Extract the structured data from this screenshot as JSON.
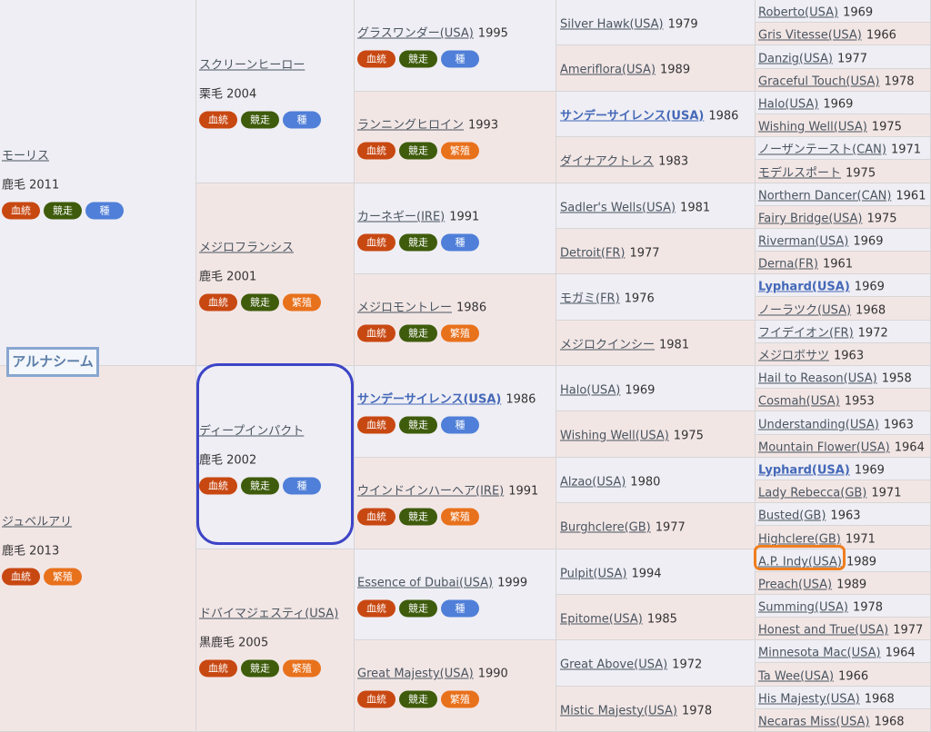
{
  "horse_name": "アルナシーム",
  "badge_labels": {
    "kettou": "血統",
    "kyoso": "競走",
    "tane": "種",
    "hanshoku": "繁殖"
  },
  "gen1": [
    {
      "name": "モーリス",
      "coat": "鹿毛 2011",
      "badges": [
        "kettou",
        "kyoso",
        "tane"
      ]
    },
    {
      "name": "ジュベルアリ",
      "coat": "鹿毛 2013",
      "badges": [
        "kettou",
        "hanshoku"
      ]
    }
  ],
  "gen2": [
    {
      "name": "スクリーンヒーロー",
      "coat": "栗毛 2004",
      "badges": [
        "kettou",
        "kyoso",
        "tane"
      ]
    },
    {
      "name": "メジロフランシス",
      "coat": "鹿毛 2001",
      "badges": [
        "kettou",
        "kyoso",
        "hanshoku"
      ]
    },
    {
      "name": "ディープインパクト",
      "coat": "鹿毛 2002",
      "badges": [
        "kettou",
        "kyoso",
        "tane"
      ]
    },
    {
      "name": "ドバイマジェスティ(USA)",
      "coat": "黒鹿毛 2005",
      "badges": [
        "kettou",
        "kyoso",
        "hanshoku"
      ]
    }
  ],
  "gen3": [
    {
      "name": "グラスワンダー(USA)",
      "year": "1995",
      "badges": [
        "kettou",
        "kyoso",
        "tane"
      ]
    },
    {
      "name": "ランニングヒロイン",
      "year": "1993",
      "badges": [
        "kettou",
        "kyoso",
        "hanshoku"
      ]
    },
    {
      "name": "カーネギー(IRE)",
      "year": "1991",
      "badges": [
        "kettou",
        "kyoso",
        "tane"
      ]
    },
    {
      "name": "メジロモントレー",
      "year": "1986",
      "badges": [
        "kettou",
        "kyoso",
        "hanshoku"
      ]
    },
    {
      "name": "サンデーサイレンス(USA)",
      "year": "1986",
      "badges": [
        "kettou",
        "kyoso",
        "tane"
      ],
      "bold": true
    },
    {
      "name": "ウインドインハーヘア(IRE)",
      "year": "1991",
      "badges": [
        "kettou",
        "kyoso",
        "hanshoku"
      ]
    },
    {
      "name": "Essence of Dubai(USA)",
      "year": "1999",
      "badges": [
        "kettou",
        "kyoso",
        "tane"
      ]
    },
    {
      "name": "Great Majesty(USA)",
      "year": "1990",
      "badges": [
        "kettou",
        "kyoso",
        "hanshoku"
      ]
    }
  ],
  "gen4": [
    {
      "name": "Silver Hawk(USA)",
      "year": "1979"
    },
    {
      "name": "Ameriflora(USA)",
      "year": "1989"
    },
    {
      "name": "サンデーサイレンス(USA)",
      "year": "1986",
      "bold": true
    },
    {
      "name": "ダイナアクトレス",
      "year": "1983"
    },
    {
      "name": "Sadler's Wells(USA)",
      "year": "1981"
    },
    {
      "name": "Detroit(FR)",
      "year": "1977"
    },
    {
      "name": "モガミ(FR)",
      "year": "1976"
    },
    {
      "name": "メジロクインシー",
      "year": "1981"
    },
    {
      "name": "Halo(USA)",
      "year": "1969"
    },
    {
      "name": "Wishing Well(USA)",
      "year": "1975"
    },
    {
      "name": "Alzao(USA)",
      "year": "1980"
    },
    {
      "name": "Burghclere(GB)",
      "year": "1977"
    },
    {
      "name": "Pulpit(USA)",
      "year": "1994"
    },
    {
      "name": "Epitome(USA)",
      "year": "1985"
    },
    {
      "name": "Great Above(USA)",
      "year": "1972"
    },
    {
      "name": "Mistic Majesty(USA)",
      "year": "1978"
    }
  ],
  "gen5": [
    {
      "name": "Roberto(USA)",
      "year": "1969"
    },
    {
      "name": "Gris Vitesse(USA)",
      "year": "1966"
    },
    {
      "name": "Danzig(USA)",
      "year": "1977"
    },
    {
      "name": "Graceful Touch(USA)",
      "year": "1978"
    },
    {
      "name": "Halo(USA)",
      "year": "1969"
    },
    {
      "name": "Wishing Well(USA)",
      "year": "1975"
    },
    {
      "name": "ノーザンテースト(CAN)",
      "year": "1971"
    },
    {
      "name": "モデルスポート",
      "year": "1975"
    },
    {
      "name": "Northern Dancer(CAN)",
      "year": "1961"
    },
    {
      "name": "Fairy Bridge(USA)",
      "year": "1975"
    },
    {
      "name": "Riverman(USA)",
      "year": "1969"
    },
    {
      "name": "Derna(FR)",
      "year": "1961"
    },
    {
      "name": "Lyphard(USA)",
      "year": "1969",
      "bold": true
    },
    {
      "name": "ノーラツク(USA)",
      "year": "1968"
    },
    {
      "name": "フイデイオン(FR)",
      "year": "1972"
    },
    {
      "name": "メジロボサツ",
      "year": "1963"
    },
    {
      "name": "Hail to Reason(USA)",
      "year": "1958"
    },
    {
      "name": "Cosmah(USA)",
      "year": "1953"
    },
    {
      "name": "Understanding(USA)",
      "year": "1963"
    },
    {
      "name": "Mountain Flower(USA)",
      "year": "1964"
    },
    {
      "name": "Lyphard(USA)",
      "year": "1969",
      "bold": true
    },
    {
      "name": "Lady Rebecca(GB)",
      "year": "1971"
    },
    {
      "name": "Busted(GB)",
      "year": "1963"
    },
    {
      "name": "Highclere(GB)",
      "year": "1971"
    },
    {
      "name": "A.P. Indy(USA)",
      "year": "1989"
    },
    {
      "name": "Preach(USA)",
      "year": "1989"
    },
    {
      "name": "Summing(USA)",
      "year": "1978"
    },
    {
      "name": "Honest and True(USA)",
      "year": "1977"
    },
    {
      "name": "Minnesota Mac(USA)",
      "year": "1964"
    },
    {
      "name": "Ta Wee(USA)",
      "year": "1966"
    },
    {
      "name": "His Majesty(USA)",
      "year": "1968"
    },
    {
      "name": "Necaras Miss(USA)",
      "year": "1968"
    }
  ]
}
